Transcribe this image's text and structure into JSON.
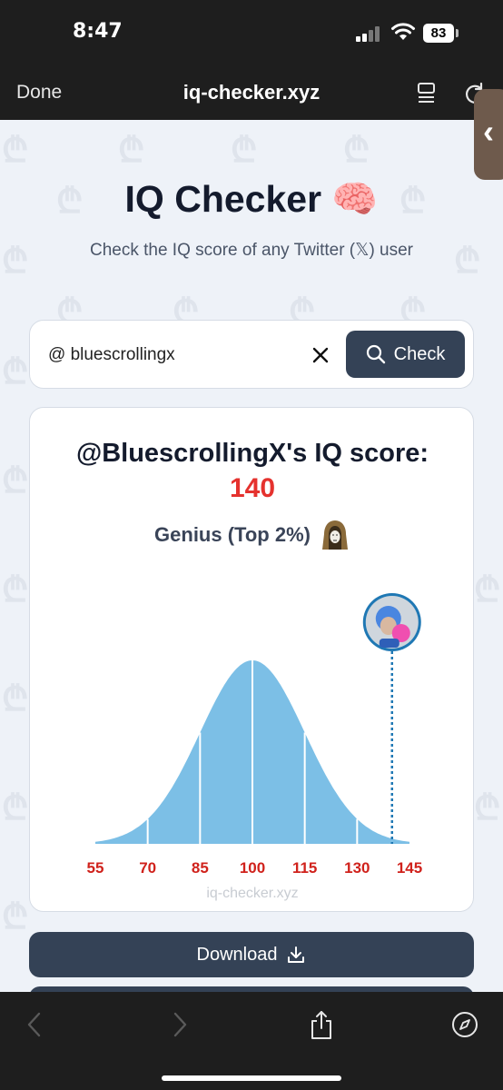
{
  "status_bar": {
    "time": "8:47",
    "battery": "83"
  },
  "browser": {
    "done_label": "Done",
    "url": "iq-checker.xyz"
  },
  "hero": {
    "title": "IQ Checker 🧠",
    "subtitle": "Check the IQ score of any Twitter (𝕏) user"
  },
  "search": {
    "value": "@ bluescrollingx",
    "button_label": "Check"
  },
  "result": {
    "heading": "@BluescrollingX's IQ score:",
    "score": "140",
    "category": "Genius (Top 2%)"
  },
  "chart_data": {
    "type": "area",
    "x_ticks": [
      "55",
      "70",
      "85",
      "100",
      "115",
      "130",
      "145"
    ],
    "x_range": [
      55,
      145
    ],
    "mean": 100,
    "std_dev": 15,
    "marker": 140,
    "fill_color": "#7cbfe6",
    "tick_color": "#d0221c"
  },
  "footer": {
    "watermark": "iq-checker.xyz",
    "download_label": "Download"
  },
  "colors": {
    "accent": "#344256",
    "score": "#e5322e"
  }
}
